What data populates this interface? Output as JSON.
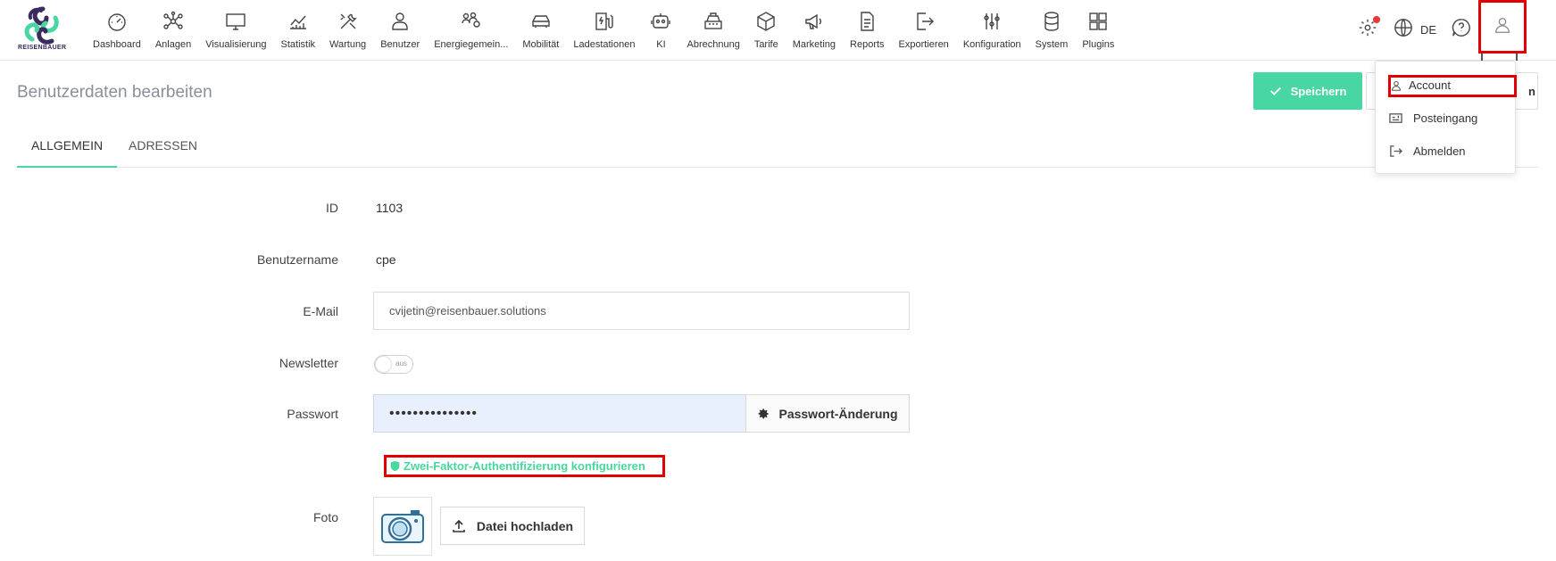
{
  "brand": {
    "name": "REISENBAUER",
    "colors": {
      "accent": "#48d6a3",
      "logo_dark": "#3b2a5e",
      "highlight": "#e00000"
    }
  },
  "nav": {
    "items": [
      {
        "label": "Dashboard",
        "icon": "gauge-icon"
      },
      {
        "label": "Anlagen",
        "icon": "network-icon"
      },
      {
        "label": "Visualisierung",
        "icon": "monitor-icon"
      },
      {
        "label": "Statistik",
        "icon": "chart-line-icon"
      },
      {
        "label": "Wartung",
        "icon": "tools-icon"
      },
      {
        "label": "Benutzer",
        "icon": "user-icon"
      },
      {
        "label": "Energiegemein...",
        "icon": "community-icon"
      },
      {
        "label": "Mobilität",
        "icon": "car-icon"
      },
      {
        "label": "Ladestationen",
        "icon": "charging-station-icon"
      },
      {
        "label": "KI",
        "icon": "robot-icon"
      },
      {
        "label": "Abrechnung",
        "icon": "cash-register-icon"
      },
      {
        "label": "Tarife",
        "icon": "box-icon"
      },
      {
        "label": "Marketing",
        "icon": "megaphone-icon"
      },
      {
        "label": "Reports",
        "icon": "document-icon"
      },
      {
        "label": "Exportieren",
        "icon": "export-icon"
      },
      {
        "label": "Konfiguration",
        "icon": "sliders-icon"
      },
      {
        "label": "System",
        "icon": "database-icon"
      },
      {
        "label": "Plugins",
        "icon": "puzzle-icon"
      }
    ]
  },
  "toolbar": {
    "language": "DE",
    "settings_icon": "gear-icon",
    "globe_icon": "globe-icon",
    "help_icon": "help-icon",
    "user_icon": "user-icon"
  },
  "header": {
    "title": "Benutzerdaten bearbeiten",
    "save_label": "Speichern",
    "second_button_visible_text": "n"
  },
  "tabs": [
    {
      "label": "ALLGEMEIN",
      "active": true
    },
    {
      "label": "ADRESSEN",
      "active": false
    }
  ],
  "form": {
    "id_label": "ID",
    "id_value": "1103",
    "username_label": "Benutzername",
    "username_value": "cpe",
    "email_label": "E-Mail",
    "email_value": "cvijetin@reisenbauer.solutions",
    "newsletter_label": "Newsletter",
    "newsletter_state": "aus",
    "password_label": "Passwort",
    "password_masked": "•••••••••••••••",
    "password_change_label": "Passwort-Änderung",
    "twofa_label": "Zwei-Faktor-Authentifizierung konfigurieren",
    "photo_label": "Foto",
    "upload_label": "Datei hochladen"
  },
  "user_menu": {
    "items": [
      {
        "label": "Account",
        "icon": "user-icon"
      },
      {
        "label": "Posteingang",
        "icon": "inbox-icon"
      },
      {
        "label": "Abmelden",
        "icon": "logout-icon"
      }
    ]
  }
}
